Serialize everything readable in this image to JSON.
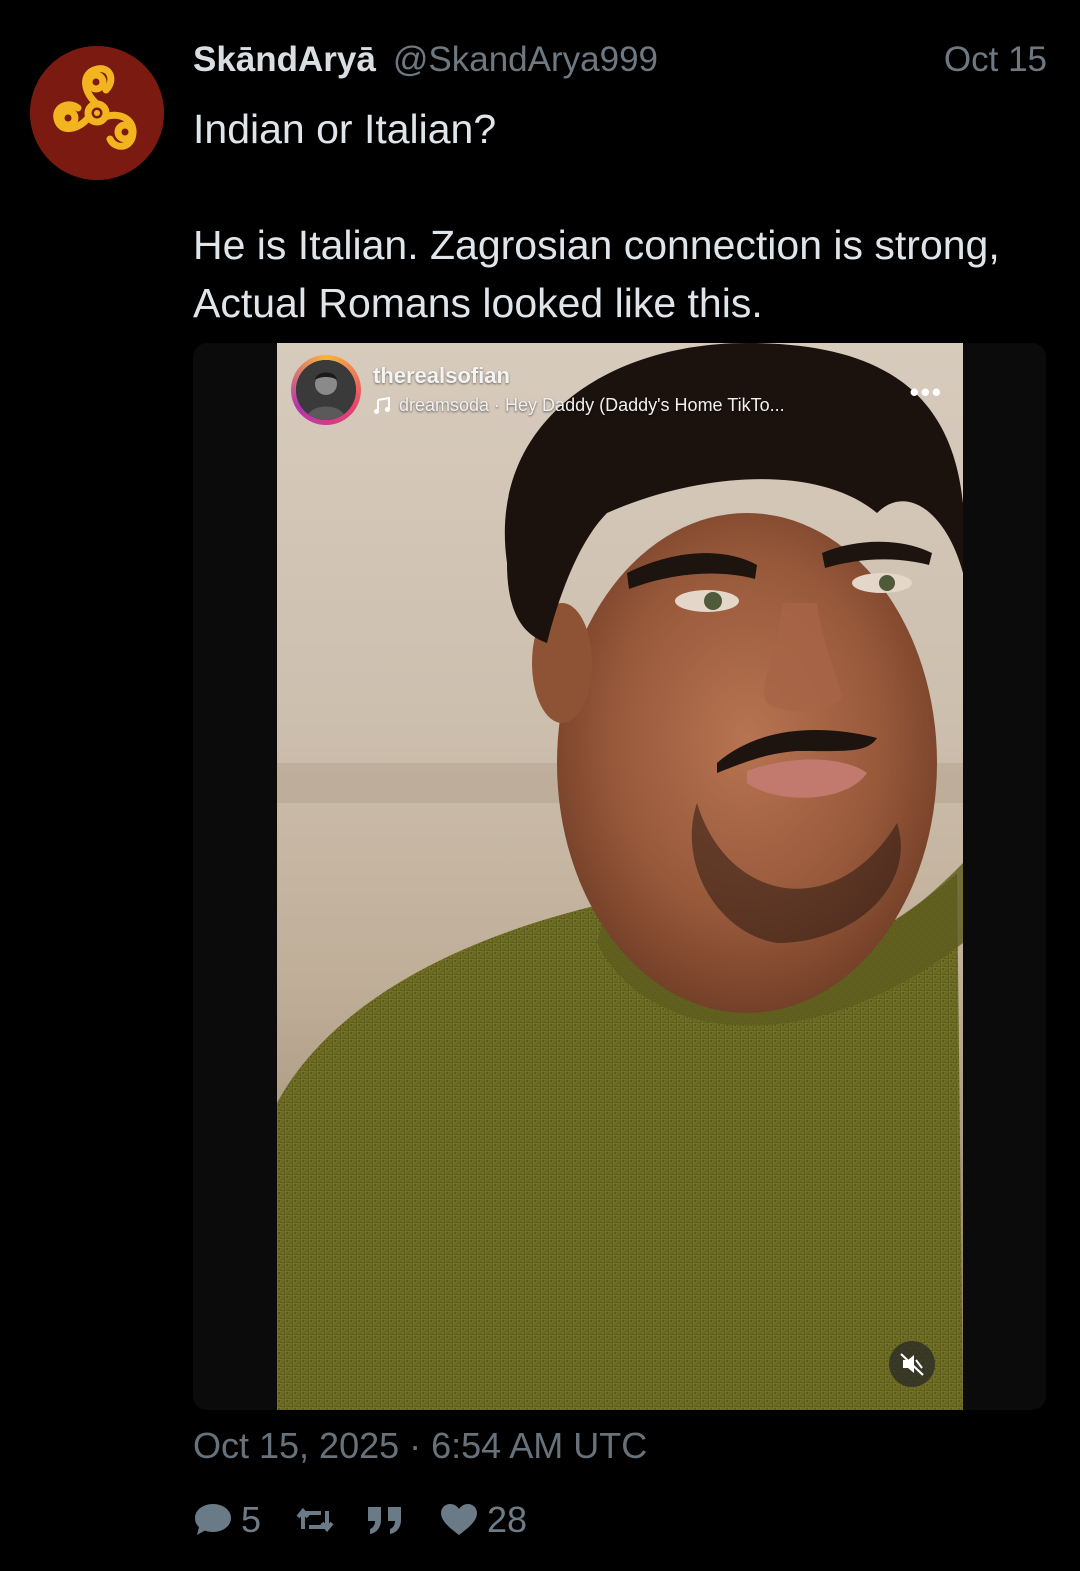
{
  "tweet": {
    "display_name": "SkāndAryā",
    "handle": "@SkandArya999",
    "date_short": "Oct 15",
    "text_line1": "Indian or Italian?",
    "text_para2": "He is Italian. Zagrosian connection is strong, Actual Romans looked like this.",
    "timestamp": "Oct 15, 2025 · 6:54 AM UTC"
  },
  "media": {
    "ig_username": "therealsofian",
    "ig_audio": "dreamsoda · Hey Daddy (Daddy's Home TikTo...",
    "more_label": "•••"
  },
  "actions": {
    "replies": "5",
    "likes": "28"
  },
  "colors": {
    "background": "#000000",
    "text": "#dfe5e9",
    "muted": "#6e7881",
    "avatar_bg": "#7a1a10",
    "avatar_symbol": "#f2b51f"
  },
  "icons": [
    "comment-icon",
    "retweet-icon",
    "quote-icon",
    "heart-icon",
    "music-note-icon",
    "mute-icon",
    "more-icon"
  ]
}
